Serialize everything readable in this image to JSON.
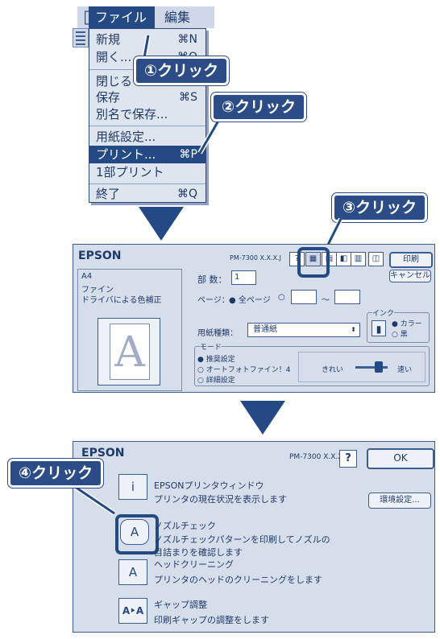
{
  "menubar": {
    "apple_glyph": "",
    "file_title": "ファイル",
    "edit_title": "編集"
  },
  "file_menu": {
    "items": [
      {
        "label": "新規",
        "shortcut": "⌘N"
      },
      {
        "label": "開く...",
        "shortcut": "⌘O"
      },
      {
        "label": "閉じる",
        "shortcut": ""
      },
      {
        "label": "保存",
        "shortcut": "⌘S"
      },
      {
        "label": "別名で保存...",
        "shortcut": ""
      },
      {
        "label": "用紙設定...",
        "shortcut": ""
      },
      {
        "label": "プリント...",
        "shortcut": "⌘P"
      },
      {
        "label": "1部プリント",
        "shortcut": ""
      },
      {
        "label": "終了",
        "shortcut": "⌘Q"
      }
    ]
  },
  "callouts": {
    "step1": "①クリック",
    "step2": "②クリック",
    "step3": "③クリック",
    "step4": "④クリック"
  },
  "print_dialog": {
    "brand": "EPSON",
    "model": "PM-7300 X.X.X.J",
    "help": "?",
    "print_button": "印刷",
    "cancel_button": "キャンセル",
    "summary": [
      "A4",
      "ファイン",
      "ドライバによる色補正"
    ],
    "preview_letter": "A",
    "copies_label": "部 数：",
    "copies_value": "1",
    "pages_label": "ページ：",
    "all_pages": "全ページ",
    "range_sep": "〜",
    "media_label": "用紙種類：",
    "media_value": "普通紙",
    "ink_group": "インク",
    "ink_color": "カラー",
    "ink_black": "黒",
    "mode_group": "モード",
    "mode_options": [
      "推奨設定",
      "オートフォトファイン！4",
      "詳細設定"
    ],
    "quality_fine": "きれい",
    "quality_fast": "速い",
    "toolbar_glyphs": [
      "▦",
      "▤",
      "◧",
      "▥",
      "◫"
    ]
  },
  "util_dialog": {
    "brand": "EPSON",
    "model": "PM-7300 X.X.X.J",
    "help": "?",
    "ok_button": "OK",
    "settings_button": "環境設定...",
    "items": [
      {
        "title": "EPSONプリンタウィンドウ",
        "desc": [
          "プリンタの現在状況を表示します"
        ],
        "icon": "i"
      },
      {
        "title": "ノズルチェック",
        "desc": [
          "ノズルチェックパターンを印刷してノズルの",
          "目詰まりを確認します"
        ],
        "icon": "A"
      },
      {
        "title": "ヘッドクリーニング",
        "desc": [
          "プリンタのヘッドのクリーニングをします"
        ],
        "icon": "A"
      },
      {
        "title": "ギャップ調整",
        "desc": [
          "印刷ギャップの調整をします"
        ],
        "icon": "A‣A"
      }
    ]
  },
  "colors": {
    "accent": "#234a85",
    "panel": "#d6deec"
  }
}
